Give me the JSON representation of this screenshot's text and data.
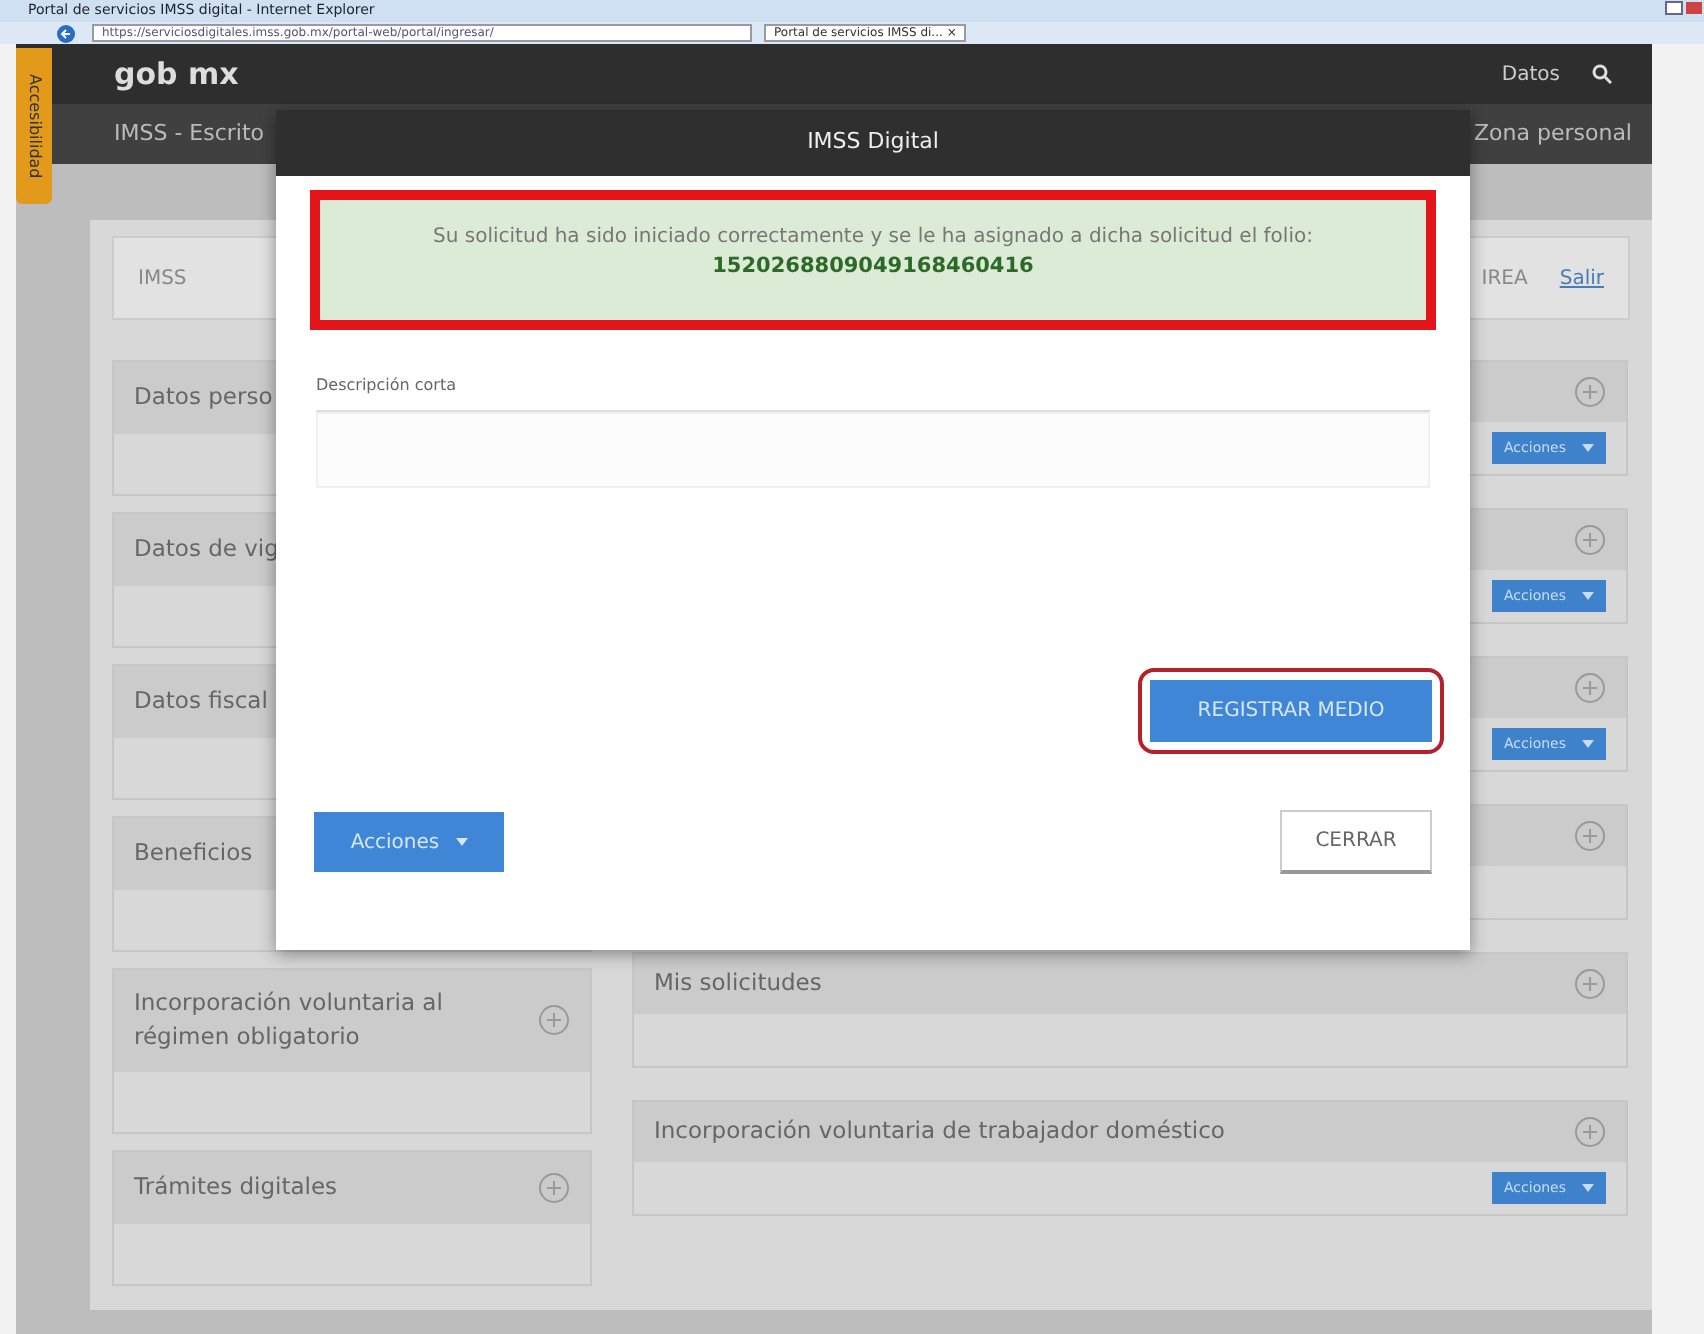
{
  "browser": {
    "title": "Portal de servicios IMSS digital - Internet Explorer",
    "address": "https://serviciosdigitales.imss.gob.mx/portal-web/portal/ingresar/",
    "tab": "Portal de servicios IMSS di...",
    "tab_close": "×"
  },
  "header": {
    "logo": "gob mx",
    "nav": "Datos",
    "subtitle": "IMSS - Escrito",
    "zone": "Zona personal",
    "accessibility": "Accesibilidad"
  },
  "user_bar": {
    "logo": "IMSS",
    "name": "IREA",
    "logout": "Salir"
  },
  "left_cards": [
    {
      "title": "Datos perso"
    },
    {
      "title": "Datos de vig"
    },
    {
      "title": "Datos fiscal"
    },
    {
      "title": "Beneficios"
    },
    {
      "title": "Incorporación voluntaria al régimen obligatorio",
      "expand_icon": true
    },
    {
      "title": "Trámites digitales",
      "expand_icon": true
    }
  ],
  "right_cards": [
    {
      "expand_icon": true,
      "actions": "Acciones"
    },
    {
      "expand_icon": true,
      "actions": "Acciones"
    },
    {
      "expand_icon": true,
      "actions": "Acciones"
    },
    {
      "expand_icon": true
    },
    {
      "title": "Mis solicitudes",
      "expand_icon": true
    },
    {
      "title": "Incorporación voluntaria de trabajador doméstico",
      "expand_icon": true,
      "actions": "Acciones"
    }
  ],
  "modal": {
    "title": "IMSS Digital",
    "message": "Su solicitud ha sido iniciado correctamente y se le ha asignado a dicha solicitud el folio:",
    "folio": "1520268809049168460416",
    "field_label": "Descripción corta",
    "register_button": "REGISTRAR MEDIO",
    "actions_button": "Acciones",
    "close_button": "CERRAR"
  }
}
